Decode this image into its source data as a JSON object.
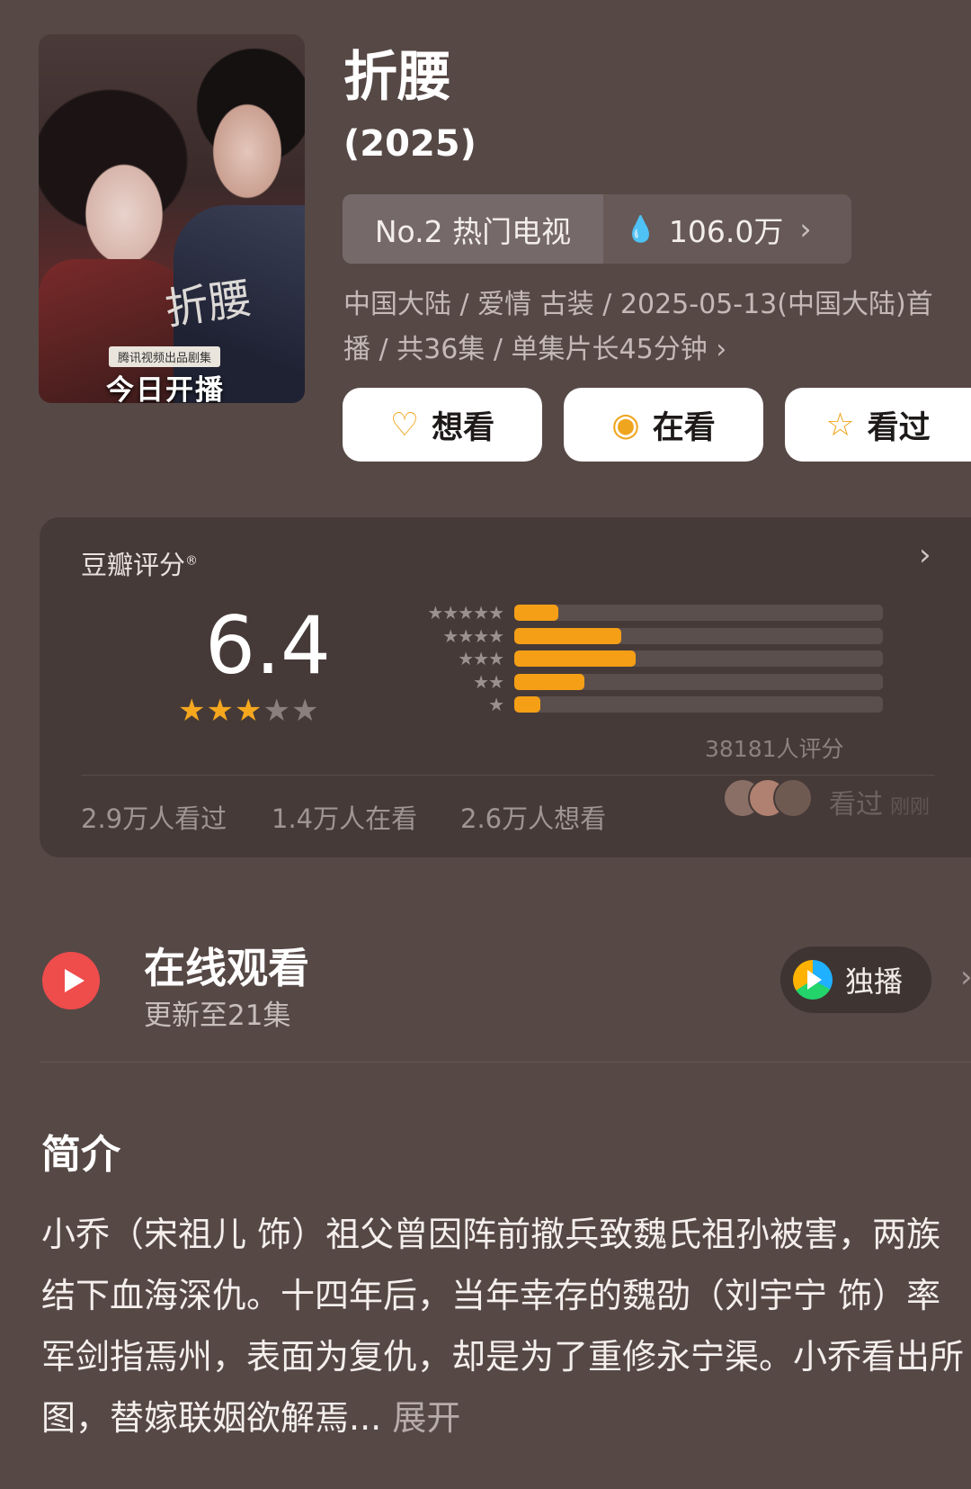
{
  "poster": {
    "calligraphy": "折腰",
    "studio": "腾讯视频出品剧集",
    "badge": "今日开播"
  },
  "title": "折腰",
  "year": "(2025)",
  "rank": {
    "label": "No.2 热门电视",
    "heat": "106.0万"
  },
  "meta": {
    "line1": "中国大陆 / 爱情 古装 / 2025-05-13(中国大陆)首",
    "line2": "播 / 共36集 / 单集片长45分钟 ›"
  },
  "actions": [
    {
      "label": "想看",
      "icon": "heart-plus-icon"
    },
    {
      "label": "在看",
      "icon": "target-icon"
    },
    {
      "label": "看过",
      "icon": "star-outline-icon"
    }
  ],
  "rating": {
    "label": "豆瓣评分",
    "score": "6.4",
    "stars_filled": 3,
    "stars_total": 5,
    "distribution": [
      {
        "stars": 5,
        "fraction": 0.12
      },
      {
        "stars": 4,
        "fraction": 0.29
      },
      {
        "stars": 3,
        "fraction": 0.33
      },
      {
        "stars": 2,
        "fraction": 0.19
      },
      {
        "stars": 1,
        "fraction": 0.07
      }
    ],
    "count_text": "38181人评分",
    "stats": [
      "2.9万人看过",
      "1.4万人在看",
      "2.6万人想看"
    ],
    "recent": {
      "action": "看过",
      "time": "刚刚"
    }
  },
  "online": {
    "title": "在线观看",
    "update": "更新至21集",
    "platform_label": "独播"
  },
  "intro": {
    "title": "简介",
    "text": "小乔（宋祖儿 饰）祖父曾因阵前撤兵致魏氏祖孙被害，两族结下血海深仇。十四年后，当年幸存的魏劭（刘宇宁 饰）率军剑指焉州，表面为复仇，却是为了重修永宁渠。小乔看出所图，替嫁联姻欲解焉...",
    "more": "展开"
  },
  "colors": {
    "background": "#564845",
    "accent": "#f59f16",
    "card": "#463a38",
    "play_red": "#ef4c4c"
  }
}
